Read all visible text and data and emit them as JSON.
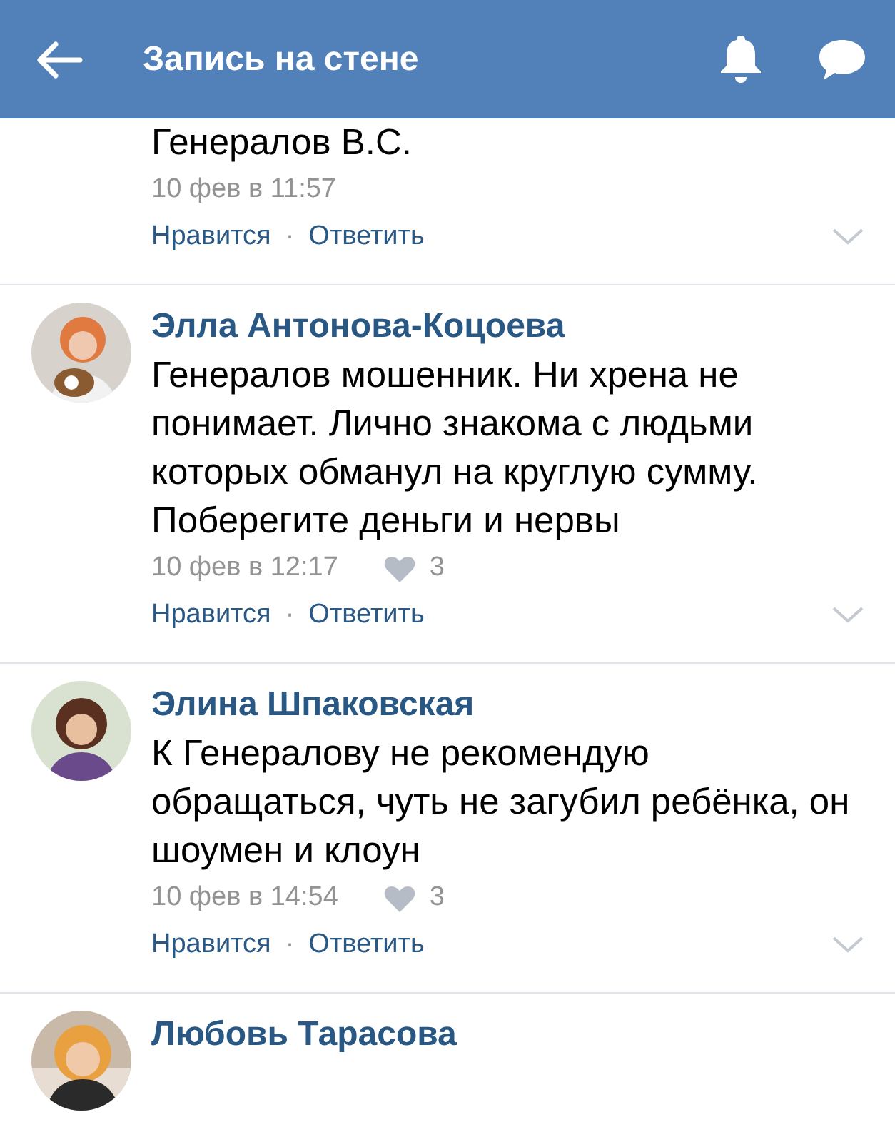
{
  "header": {
    "title": "Запись на стене"
  },
  "comments": [
    {
      "text": "Генералов В.С.",
      "date": "10 фев в 11:57",
      "actions": {
        "like": "Нравится",
        "separator": "·",
        "reply": "Ответить"
      }
    },
    {
      "author": "Элла Антонова-Коцоева",
      "text": "Генералов мошенник. Ни хрена не понимает. Лично знакома с людьми которых обманул на круглую сумму. Поберегите деньги и нервы",
      "date": "10 фев в 12:17",
      "likes": "3",
      "actions": {
        "like": "Нравится",
        "separator": "·",
        "reply": "Ответить"
      }
    },
    {
      "author": "Элина Шпаковская",
      "text": "К Генералову не рекомендую обращаться, чуть не загубил ребёнка, он шоумен и клоун",
      "date": "10 фев в 14:54",
      "likes": "3",
      "actions": {
        "like": "Нравится",
        "separator": "·",
        "reply": "Ответить"
      }
    },
    {
      "author": "Любовь Тарасова"
    }
  ]
}
